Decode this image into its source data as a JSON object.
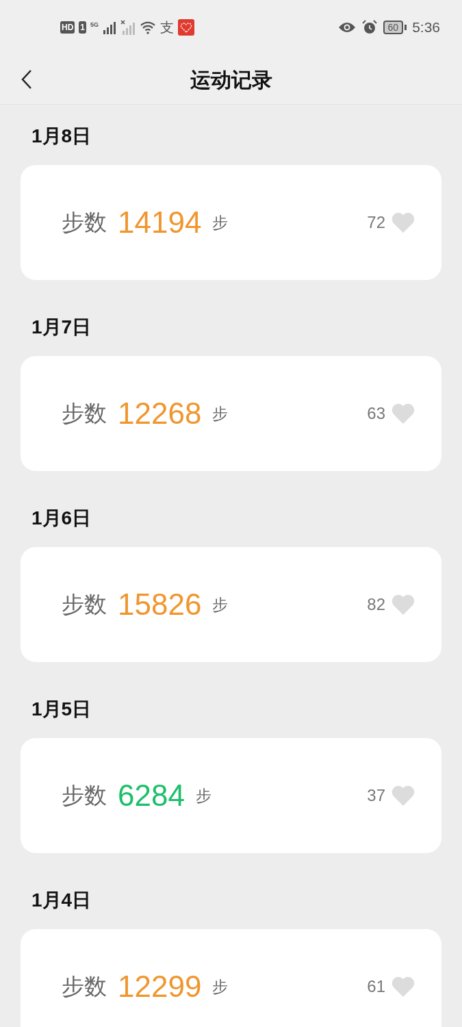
{
  "status_bar": {
    "hd": "HD",
    "sim": "1",
    "network": "5G",
    "app_glyph": "支",
    "battery": "60",
    "time": "5:36"
  },
  "header": {
    "title": "运动记录"
  },
  "days": [
    {
      "date": "1月8日",
      "label": "步数",
      "steps": "14194",
      "unit": "步",
      "color": "#f0962e",
      "likes": "72"
    },
    {
      "date": "1月7日",
      "label": "步数",
      "steps": "12268",
      "unit": "步",
      "color": "#f0962e",
      "likes": "63"
    },
    {
      "date": "1月6日",
      "label": "步数",
      "steps": "15826",
      "unit": "步",
      "color": "#f0962e",
      "likes": "82"
    },
    {
      "date": "1月5日",
      "label": "步数",
      "steps": "6284",
      "unit": "步",
      "color": "#1dbf6a",
      "likes": "37"
    },
    {
      "date": "1月4日",
      "label": "步数",
      "steps": "12299",
      "unit": "步",
      "color": "#f0962e",
      "likes": "61"
    }
  ]
}
